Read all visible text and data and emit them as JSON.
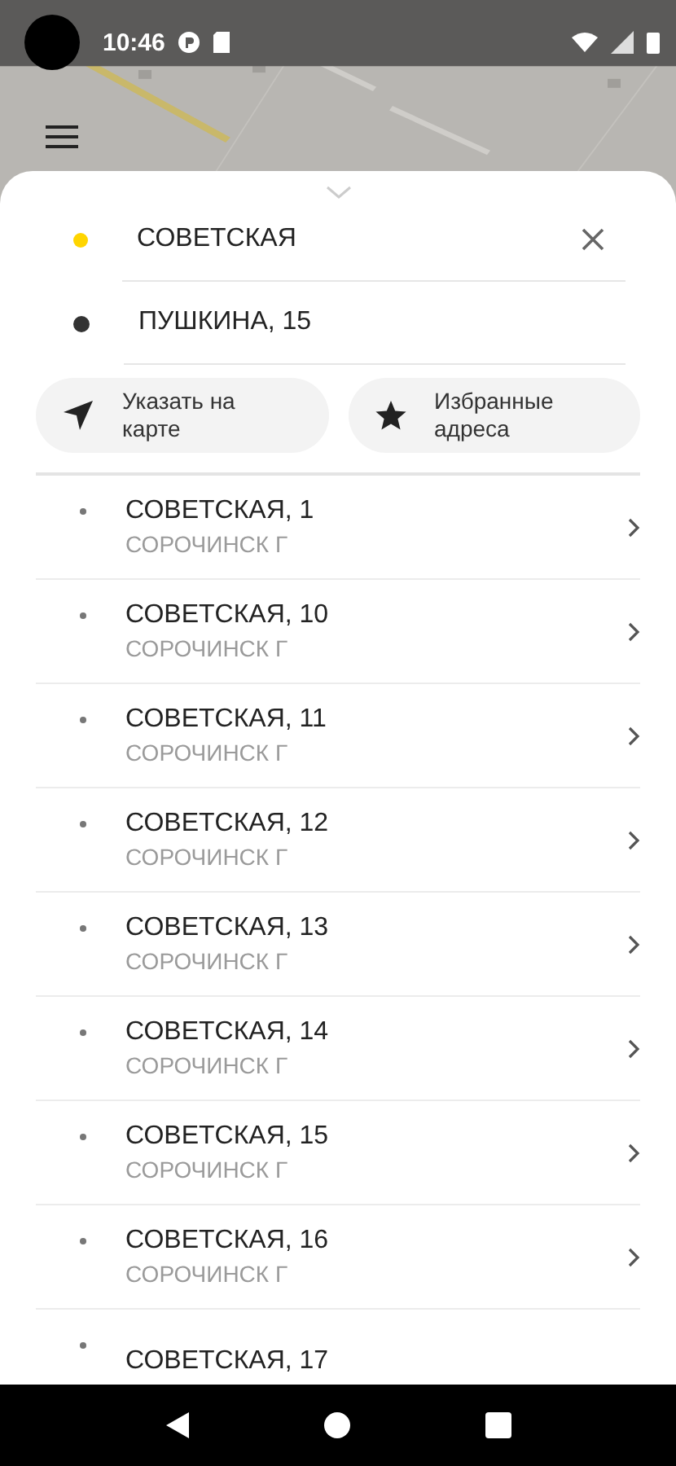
{
  "status_bar": {
    "time": "10:46"
  },
  "route": [
    {
      "kind": "origin",
      "value": "СОВЕТСКАЯ",
      "color": "#ffd500",
      "clearable": true
    },
    {
      "kind": "destination",
      "value": "ПУШКИНА, 15",
      "color": "#333333",
      "clearable": false
    }
  ],
  "actions": [
    {
      "kind": "map",
      "label": "Указать на карте"
    },
    {
      "kind": "favorites",
      "label": "Избранные адреса"
    }
  ],
  "suggestions": [
    {
      "title": "СОВЕТСКАЯ, 1",
      "subtitle": "СОРОЧИНСК Г"
    },
    {
      "title": "СОВЕТСКАЯ, 10",
      "subtitle": "СОРОЧИНСК Г"
    },
    {
      "title": "СОВЕТСКАЯ, 11",
      "subtitle": "СОРОЧИНСК Г"
    },
    {
      "title": "СОВЕТСКАЯ, 12",
      "subtitle": "СОРОЧИНСК Г"
    },
    {
      "title": "СОВЕТСКАЯ, 13",
      "subtitle": "СОРОЧИНСК Г"
    },
    {
      "title": "СОВЕТСКАЯ, 14",
      "subtitle": "СОРОЧИНСК Г"
    },
    {
      "title": "СОВЕТСКАЯ, 15",
      "subtitle": "СОРОЧИНСК Г"
    },
    {
      "title": "СОВЕТСКАЯ, 16",
      "subtitle": "СОРОЧИНСК Г"
    },
    {
      "title": "СОВЕТСКАЯ, 17"
    }
  ]
}
